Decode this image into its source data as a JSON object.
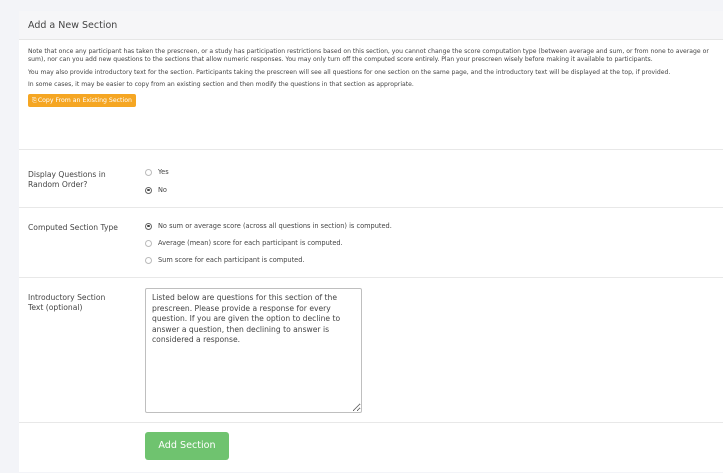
{
  "section": {
    "title": "Add a New Section",
    "intro": {
      "para1": "Note that once any participant has taken the prescreen, or a study has participation restrictions based on this section, you cannot change the score computation type (between average and sum, or from none to average or sum), nor can you add new questions to the sections that allow numeric responses. You may only turn off the computed score entirely. Plan your prescreen wisely before making it available to participants.",
      "para2": "You may also provide introductory text for the section. Participants taking the prescreen will see all questions for one section on the same page, and the introductory text will be displayed at the top, if provided.",
      "para3": "In some cases, it may be easier to copy from an existing section and then modify the questions in that section as appropriate.",
      "copy_button": "Copy From an Existing Section"
    },
    "random_order": {
      "label": "Display Questions in Random Order?",
      "options": [
        {
          "label": "Yes",
          "selected": false
        },
        {
          "label": "No",
          "selected": true
        }
      ]
    },
    "computed_type": {
      "label": "Computed Section Type",
      "options": [
        {
          "label": "No sum or average score (across all questions in section) is computed.",
          "selected": true
        },
        {
          "label": "Average (mean) score for each participant is computed.",
          "selected": false
        },
        {
          "label": "Sum score for each participant is computed.",
          "selected": false
        }
      ]
    },
    "intro_text": {
      "label": "Introductory Section Text (optional)",
      "value": "Listed below are questions for this section of the prescreen. Please provide a response for every question. If you are given the option to decline to answer a question, then declining to answer is considered a response."
    },
    "submit_label": "Add Section"
  },
  "colors": {
    "accent_orange": "#f5a623",
    "accent_green": "#6fc36f"
  }
}
